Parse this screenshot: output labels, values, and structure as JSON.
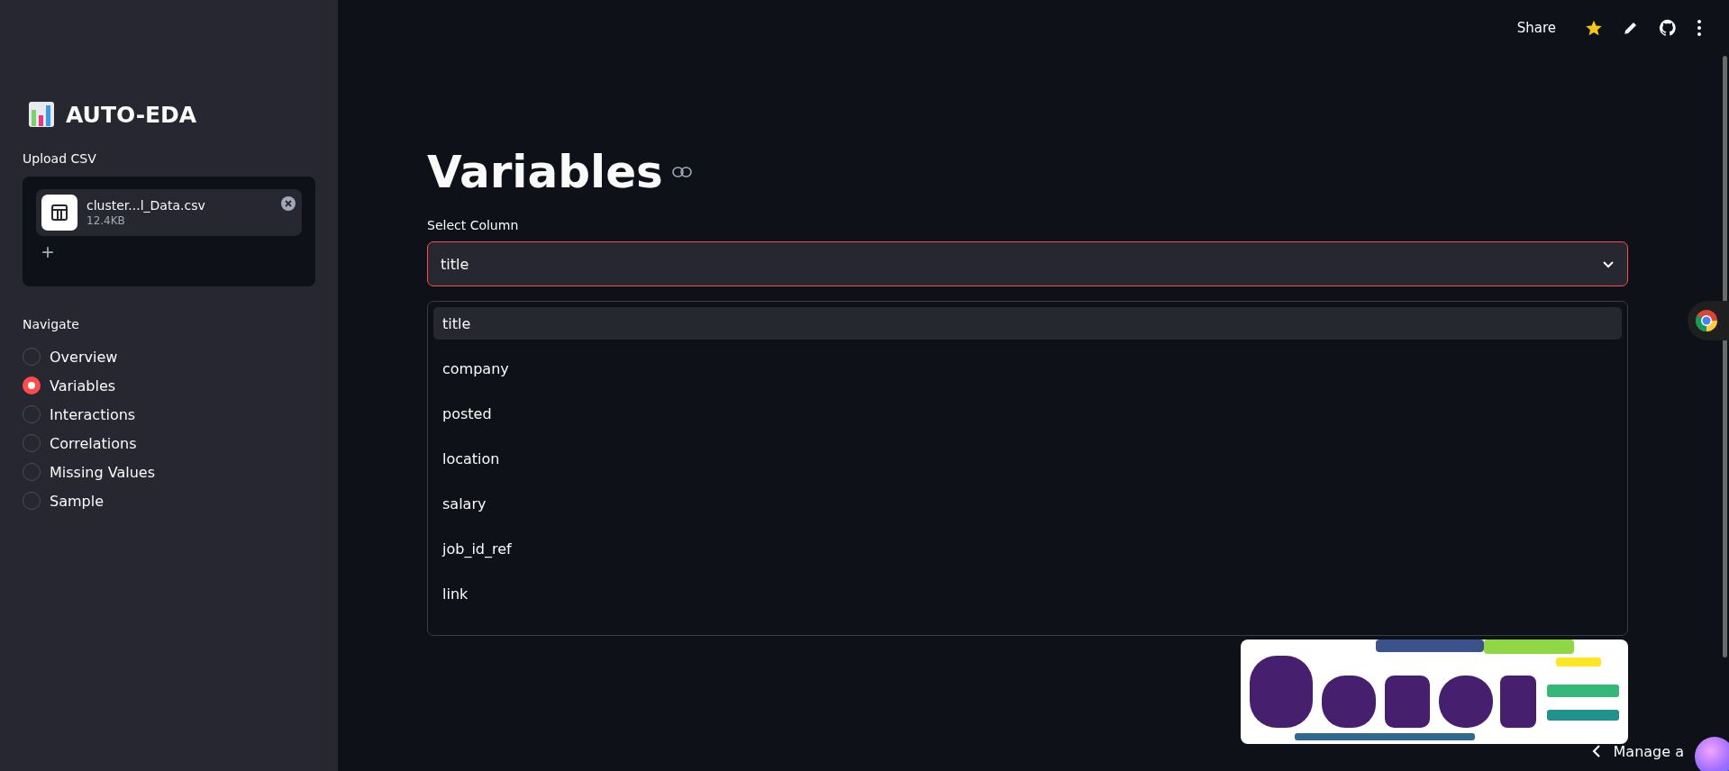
{
  "sidebar": {
    "title": "AUTO-EDA",
    "upload": {
      "label": "Upload CSV",
      "file_name": "cluster...l_Data.csv",
      "file_size": "12.4KB",
      "add": "+"
    },
    "navigate": {
      "label": "Navigate",
      "options": [
        {
          "label": "Overview",
          "selected": false
        },
        {
          "label": "Variables",
          "selected": true
        },
        {
          "label": "Interactions",
          "selected": false
        },
        {
          "label": "Correlations",
          "selected": false
        },
        {
          "label": "Missing Values",
          "selected": false
        },
        {
          "label": "Sample",
          "selected": false
        }
      ]
    }
  },
  "toolbar": {
    "share": "Share"
  },
  "main": {
    "heading": "Variables",
    "select": {
      "label": "Select Column",
      "value": "title",
      "expanded": true,
      "options": [
        {
          "label": "title",
          "selected": true
        },
        {
          "label": "company",
          "selected": false
        },
        {
          "label": "posted",
          "selected": false
        },
        {
          "label": "location",
          "selected": false
        },
        {
          "label": "salary",
          "selected": false
        },
        {
          "label": "job_id_ref",
          "selected": false
        },
        {
          "label": "link",
          "selected": false
        }
      ]
    }
  },
  "footer": {
    "manage": "Manage a"
  }
}
